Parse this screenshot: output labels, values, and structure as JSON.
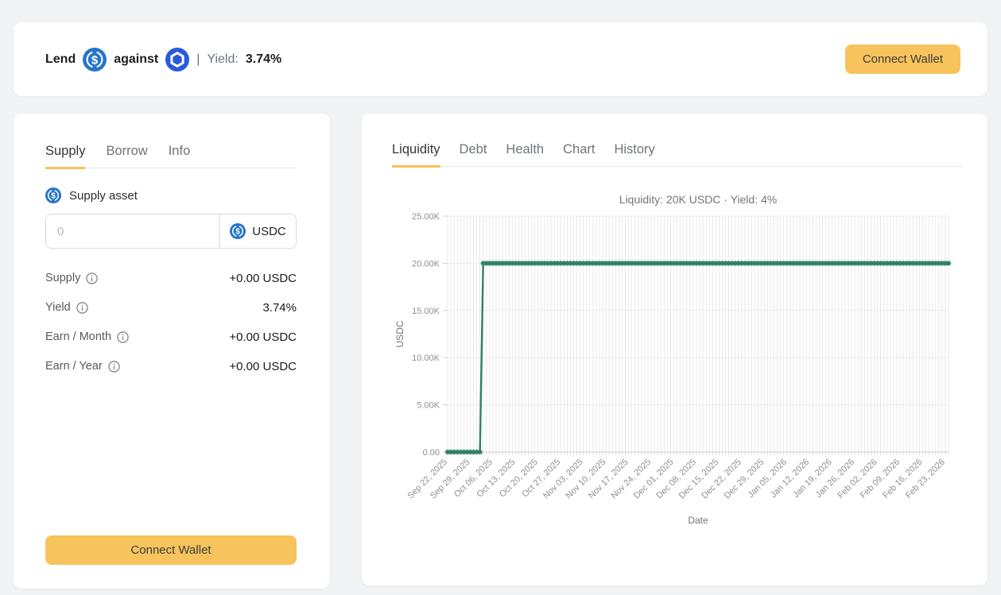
{
  "header": {
    "lend_label": "Lend",
    "against_label": "against",
    "separator": "|",
    "yield_label": "Yield:",
    "yield_value": "3.74%",
    "connect_wallet_label": "Connect Wallet",
    "supply_asset_icon": "usdc-icon",
    "collateral_asset_icon": "chainlink-icon"
  },
  "colors": {
    "accent_amber": "#f7c35c",
    "usdc_blue": "#2775CA",
    "chainlink_blue": "#2A5ADA",
    "chart_green": "#2E8164",
    "page_background": "#f2f3f5"
  },
  "left_panel": {
    "tabs": [
      {
        "label": "Supply",
        "active": true
      },
      {
        "label": "Borrow",
        "active": false
      },
      {
        "label": "Info",
        "active": false
      }
    ],
    "supply_asset_label": "Supply asset",
    "amount_input": {
      "value": "",
      "placeholder": "0"
    },
    "asset_selector": {
      "label": "USDC",
      "icon": "usdc-icon"
    },
    "rows": [
      {
        "label": "Supply",
        "value": "+0.00 USDC",
        "has_info_icon": true
      },
      {
        "label": "Yield",
        "value": "3.74%",
        "has_info_icon": true
      },
      {
        "label": "Earn / Month",
        "value": "+0.00 USDC",
        "has_info_icon": true
      },
      {
        "label": "Earn / Year",
        "value": "+0.00 USDC",
        "has_info_icon": true
      }
    ],
    "connect_wallet_label": "Connect Wallet"
  },
  "right_panel": {
    "tabs": [
      {
        "label": "Liquidity",
        "active": true
      },
      {
        "label": "Debt",
        "active": false
      },
      {
        "label": "Health",
        "active": false
      },
      {
        "label": "Chart",
        "active": false
      },
      {
        "label": "History",
        "active": false
      }
    ]
  },
  "chart_data": {
    "type": "line",
    "title": "Liquidity: 20K USDC · Yield: 4%",
    "xlabel": "Date",
    "ylabel": "USDC",
    "ylim": [
      0,
      25000
    ],
    "y_tick_values": [
      0,
      5000,
      10000,
      15000,
      20000,
      25000
    ],
    "y_tick_labels": [
      "0.00",
      "5.00K",
      "10.00K",
      "15.00K",
      "20.00K",
      "25.00K"
    ],
    "x_tick_labels": [
      "Sep 22, 2025",
      "Sep 29, 2025",
      "Oct 06, 2025",
      "Oct 13, 2025",
      "Oct 20, 2025",
      "Oct 27, 2025",
      "Nov 03, 2025",
      "Nov 10, 2025",
      "Nov 17, 2025",
      "Nov 24, 2025",
      "Dec 01, 2025",
      "Dec 08, 2025",
      "Dec 15, 2025",
      "Dec 22, 2025",
      "Dec 29, 2025",
      "Jan 05, 2026",
      "Jan 12, 2026",
      "Jan 19, 2026",
      "Jan 26, 2026",
      "Feb 02, 2026",
      "Feb 09, 2026",
      "Feb 16, 2026",
      "Feb 23, 2026"
    ],
    "x_tick_interval_days": 7,
    "grid": {
      "daily_vertical_lines": true,
      "horizontal_lines": true
    },
    "legend": "none",
    "series": [
      {
        "name": "Liquidity",
        "color": "#2E8164",
        "point_style": "circle",
        "days_total": 156,
        "start_date": "Sep 22, 2025",
        "end_date": "Feb 24, 2026",
        "value_before": 0,
        "jump_date": "Oct 03, 2025",
        "jump_day_index": 11,
        "value_after": 20000
      }
    ]
  }
}
